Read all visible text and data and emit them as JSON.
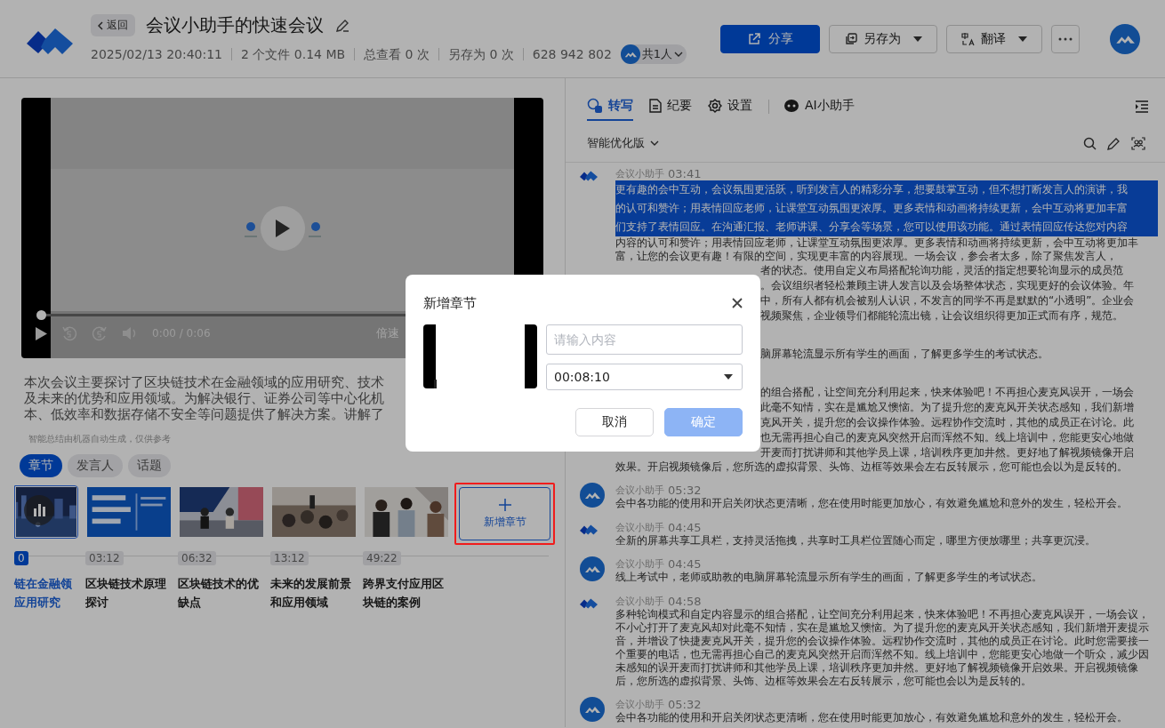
{
  "header": {
    "back": "返回",
    "title": "会议小助手的快速会议",
    "meta": [
      "2025/02/13 20:40:11",
      "2 个文件 0.14 MB",
      "总查看 0 次",
      "另存为 0 次",
      "628 942 802"
    ],
    "members": "共1人",
    "actions": [
      {
        "kind": "primary",
        "label": "分享"
      },
      {
        "kind": "menu",
        "label": "另存为"
      },
      {
        "kind": "menu",
        "label": "翻译"
      },
      {
        "kind": "more"
      }
    ]
  },
  "video": {
    "level": 0,
    "time": "0:00 / 0:06",
    "speed": "倍速"
  },
  "summary": {
    "lines": [
      "本次会议主要探讨了区块链技术在金融领域的应用研究、技术",
      "及未来的优势和应用领域。为解决银行、证券公司等中心化机",
      "本、低效率和数据存储不安全等问题提供了解决方案。讲解了"
    ],
    "note": "智能总结由机器自动生成，仅供参考"
  },
  "chapter_tabs": [
    {
      "label": "章节",
      "selected": true
    },
    {
      "label": "发言人",
      "selected": false
    },
    {
      "label": "话题",
      "selected": false
    }
  ],
  "chapters": [
    {
      "time": "0",
      "title_lines": [
        "链在金融领",
        "应用研究"
      ],
      "selected": true
    },
    {
      "time": "03:12",
      "title_lines": [
        "区块链技术原理",
        "探讨"
      ],
      "selected": false
    },
    {
      "time": "06:32",
      "title_lines": [
        "区块链技术的优",
        "缺点"
      ],
      "selected": false
    },
    {
      "time": "13:12",
      "title_lines": [
        "未来的发展前景",
        "和应用领域"
      ],
      "selected": false
    },
    {
      "time": "49:22",
      "title_lines": [
        "跨界支付应用区",
        "块链的案例"
      ],
      "selected": false
    }
  ],
  "add_chapter": "新增章节",
  "panel_tabs": [
    {
      "label": "转写",
      "selected": true
    },
    {
      "label": "纪要",
      "selected": false
    },
    {
      "label": "设置",
      "selected": false
    },
    {
      "label": "AI小助手",
      "selected": false
    }
  ],
  "version": "智能优化版",
  "transcript": [
    {
      "kind": "logo",
      "speaker": "会议小助手",
      "time": "03:41",
      "lines": [
        {
          "kind": "full",
          "selected": true,
          "text": "更有趣的会中互动，会议氛围更活跃，听到发言人的精彩分享，想要鼓掌互动，但不想打断发言人的演讲，我"
        },
        {
          "kind": "full",
          "selected": true,
          "text": "的认可和赞许；用表情回应老师，让课堂互动氛围更浓厚。更多表情和动画将持续更新，会中互动将更加丰富"
        },
        {
          "kind": "full",
          "selected": true,
          "text": "们支持了表情回应。在沟通汇报、老师讲课、分享会等场景，您可以使用该功能。通过表情回应传达您对内容"
        },
        {
          "kind": "full",
          "selected": false,
          "text": "内容的认可和赞许；用表情回应老师，让课堂互动氛围更浓厚。更多表情和动画将持续更新，会中互动将更加丰"
        },
        {
          "kind": "full",
          "selected": false,
          "text": "富，让您的会议更有趣！有限的空间，实现更丰富的内容展现。一场会议，参会者太多，除了聚焦发言人，"
        },
        {
          "kind": "covered",
          "selected": false,
          "text": "者的状态。使用自定义布局搭配轮询功能，灵活的指定想要轮询显示的成员范"
        },
        {
          "kind": "covered",
          "selected": false,
          "text": "。会议组织者轻松兼顾主讲人发言以及会场整体状态，实现更好的会议体验。年"
        },
        {
          "kind": "covered",
          "selected": false,
          "text": "中，所有人都有机会被别人认识，不发言的同学不再是默默的“小透明”。企业会"
        },
        {
          "kind": "covered",
          "selected": false,
          "text": "视频聚焦，企业领导们都能轮流出镜，让会议组织得更加正式而有序，规范。"
        }
      ]
    },
    {
      "kind": "fragment",
      "lines": [
        {
          "kind": "covered",
          "selected": false,
          "text": "脑屏幕轮流显示所有学生的画面，了解更多学生的考试状态。"
        }
      ]
    },
    {
      "kind": "fragment",
      "lines": [
        {
          "kind": "covered",
          "selected": false,
          "text": "的组合搭配，让空间充分利用起来，快来体验吧！不再担心麦克风误开，一场会"
        },
        {
          "kind": "covered",
          "selected": false,
          "text": "此毫不知情，实在是尴尬又懊恼。为了提升您的麦克风开关状态感知，我们新增"
        },
        {
          "kind": "covered",
          "selected": false,
          "text": "克风开关，提升您的会议操作体验。远程协作交流时，其他的成员正在讨论。此"
        },
        {
          "kind": "covered",
          "selected": false,
          "text": "也无需再担心自己的麦克风突然开启而浑然不知。线上培训中，您能更安心地做"
        },
        {
          "kind": "covered",
          "selected": false,
          "text": "开麦而打扰讲师和其他学员上课，培训秩序更加井然。更好地了解视频镜像开启"
        },
        {
          "kind": "full",
          "selected": false,
          "text": "效果。开启视频镜像后，您所选的虚拟背景、头饰、边框等效果会左右反转展示，您可能也会以为是反转的。"
        }
      ]
    },
    {
      "kind": "round",
      "speaker": "会议小助手",
      "time": "05:32",
      "text": "会中各功能的使用和开启关闭状态更清晰，您在使用时能更加放心，有效避免尴尬和意外的发生，轻松开会。"
    },
    {
      "kind": "logo",
      "speaker": "会议小助手",
      "time": "04:45",
      "text": "全新的屏幕共享工具栏，支持灵活拖拽，共享时工具栏位置随心而定，哪里方便放哪里；共享更沉浸。"
    },
    {
      "kind": "round",
      "speaker": "会议小助手",
      "time": "04:45",
      "text": "线上考试中，老师或助教的电脑屏幕轮流显示所有学生的画面，了解更多学生的考试状态。"
    },
    {
      "kind": "logo",
      "speaker": "会议小助手",
      "time": "04:58",
      "text": "多种轮询模式和自定内容显示的组合搭配，让空间充分利用起来，快来体验吧！不再担心麦克风误开，一场会议，不小心打开了麦克风却对此毫不知情，实在是尴尬又懊恼。为了提升您的麦克风开关状态感知，我们新增开麦提示音，并增设了快捷麦克风开关，提升您的会议操作体验。远程协作交流时，其他的成员正在讨论。此时您需要接一个重要的电话，也无需再担心自己的麦克风突然开启而浑然不知。线上培训中，您能更安心地做一个听众，减少因未感知的误开麦而打扰讲师和其他学员上课，培训秩序更加井然。更好地了解视频镜像开启效果。开启视频镜像后，您所选的虚拟背景、头饰、边框等效果会左右反转展示，您可能也会以为是反转的。"
    },
    {
      "kind": "round",
      "speaker": "会议小助手",
      "time": "05:32",
      "text": "会中各功能的使用和开启关闭状态更清晰，您在使用时能更加放心，有效避免尴尬和意外的发生，轻松开会。"
    }
  ],
  "dialog": {
    "title": "新增章节",
    "placeholder": "请输入内容",
    "time": "00:08:10",
    "buttons": [
      {
        "kind": "secondary",
        "label": "取消",
        "disabled": false
      },
      {
        "kind": "primary",
        "label": "确定",
        "disabled": true
      }
    ]
  }
}
